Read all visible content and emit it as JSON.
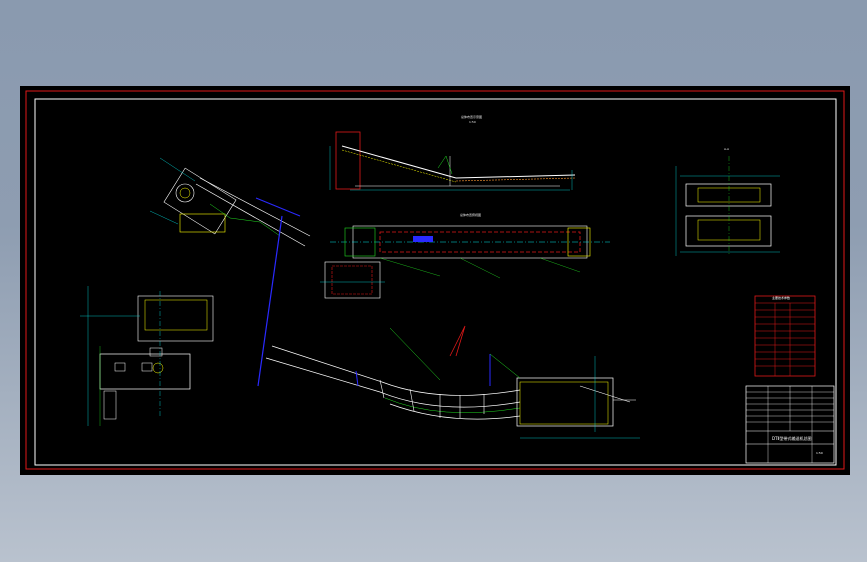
{
  "drawing": {
    "view_labels": {
      "side_elevation": "总体布置示意图",
      "side_scale": "1:50",
      "plan_view": "总体布置俯视图",
      "section_title": "A-A",
      "detail_small": "1:20"
    },
    "parts_table": {
      "title": "主要技术参数"
    },
    "title_block": {
      "drawing_name": "DTⅡ型带式输送机总图",
      "scale": "1:50"
    }
  },
  "colors": {
    "background": "#000000",
    "frame_red": "#e01818",
    "structure_white": "#ffffff",
    "dimension_cyan": "#00e5e5",
    "centerline_green": "#22dd22",
    "yellow": "#ffff00",
    "magenta": "#ff33ff",
    "blue": "#2a2aff",
    "orange": "#ff9933"
  }
}
